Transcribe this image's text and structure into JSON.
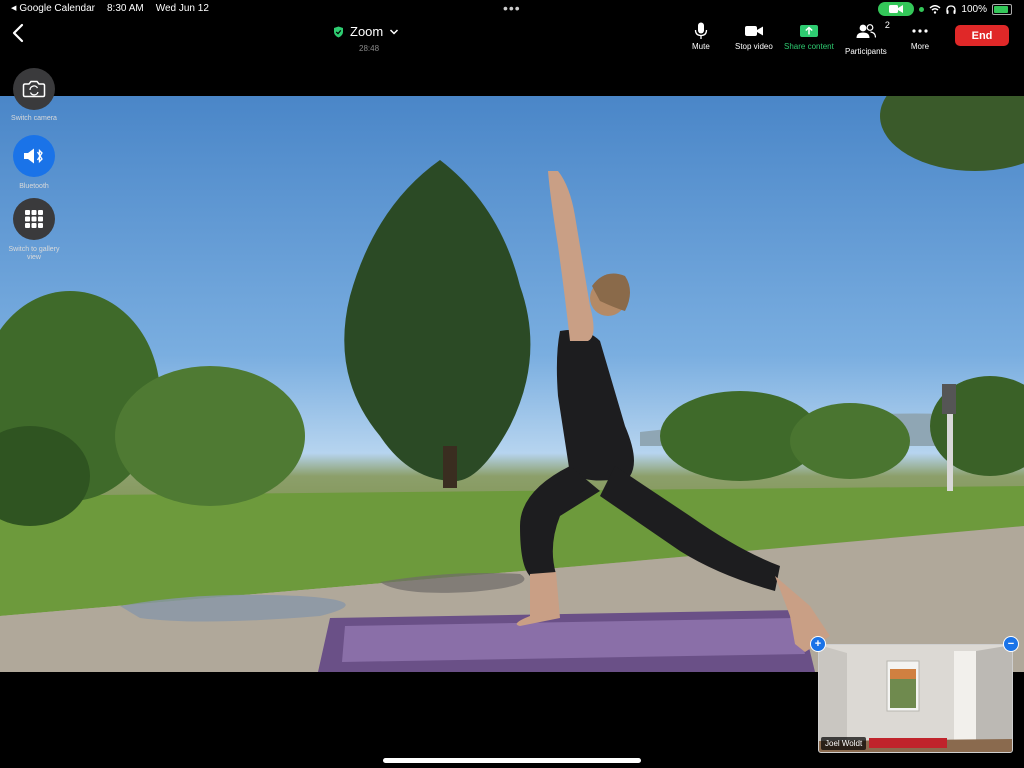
{
  "status_bar": {
    "back_app": "Google Calendar",
    "time": "8:30 AM",
    "date": "Wed Jun 12",
    "battery": "100%",
    "battery_level": 1.0
  },
  "toolbar": {
    "meeting_name": "Zoom",
    "timer": "28:48",
    "mute_label": "Mute",
    "stop_video_label": "Stop video",
    "share_label": "Share content",
    "participants_label": "Participants",
    "participants_count": "2",
    "more_label": "More",
    "end_label": "End"
  },
  "side_controls": {
    "switch_camera_label": "Switch camera",
    "bluetooth_label": "Bluetooth",
    "switch_view_label": "Switch to gallery view"
  },
  "thumbnail": {
    "name": "Joel Woldt"
  },
  "colors": {
    "accent_blue": "#1a73e8",
    "end_red": "#e02828",
    "share_green": "#2ecc71",
    "status_green": "#34c759"
  },
  "icons": [
    "back-icon",
    "shield-check-icon",
    "chevron-down-icon",
    "microphone-icon",
    "video-camera-icon",
    "share-screen-icon",
    "participants-icon",
    "ellipsis-icon",
    "switch-camera-icon",
    "bluetooth-speaker-icon",
    "grid-icon",
    "plus-icon",
    "minus-icon",
    "wifi-icon",
    "headphones-icon",
    "battery-icon"
  ]
}
